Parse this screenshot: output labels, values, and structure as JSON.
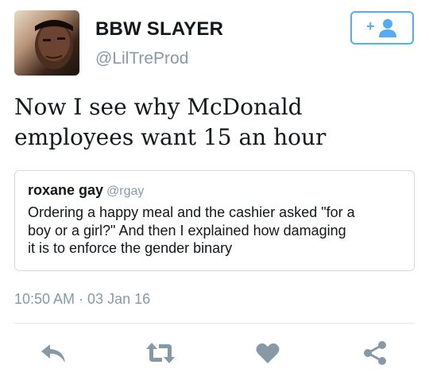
{
  "author": {
    "display_name": "BBW SLAYER",
    "handle": "@LilTreProd"
  },
  "follow_button": {
    "icon": "add-user-icon",
    "label": "+"
  },
  "tweet": {
    "text_lines": [
      "Now I see why McDonald",
      "employees want 15 an hour"
    ]
  },
  "quoted_tweet": {
    "name": "roxane gay",
    "handle": "@rgay",
    "text_lines": [
      "Ordering a happy meal and the cashier asked \"for a",
      "boy or a girl?\" And then I explained how damaging",
      "it is to enforce the gender binary"
    ]
  },
  "timestamp": "10:50 AM · 03 Jan 16",
  "actions": [
    {
      "name": "reply",
      "icon": "reply-icon"
    },
    {
      "name": "retweet",
      "icon": "retweet-icon"
    },
    {
      "name": "like",
      "icon": "heart-icon"
    },
    {
      "name": "share",
      "icon": "share-icon"
    }
  ],
  "colors": {
    "accent": "#55acee",
    "icon_gray": "#8899a6",
    "text": "#14171a",
    "secondary_text": "#8899a6",
    "border": "#d5dce1"
  }
}
